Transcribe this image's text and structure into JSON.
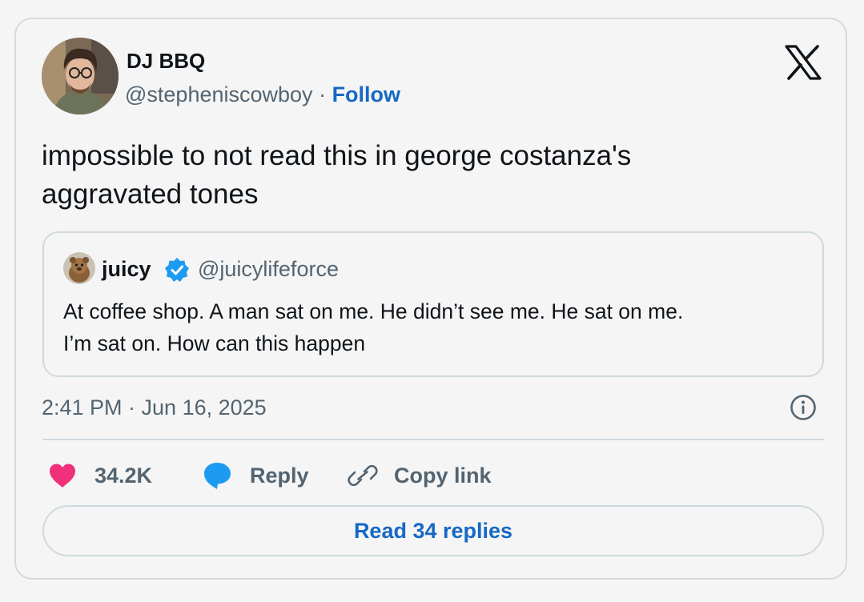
{
  "tweet": {
    "author": {
      "display_name": "DJ BBQ",
      "handle": "@stepheniscowboy",
      "separator": "·",
      "follow_label": "Follow",
      "avatar_icon": "profile-photo-avatar"
    },
    "brand_icon": "x-logo-icon",
    "text_line1": "impossible to not read this in george costanza's",
    "text_line2": "aggravated tones",
    "quoted": {
      "display_name": "juicy",
      "verified_icon": "verified-badge-icon",
      "handle": "@juicylifeforce",
      "text_line1": "At coffee shop. A man sat on me. He didn’t see me. He sat on me.",
      "text_line2": "I’m sat on. How can this happen"
    },
    "timestamp": "2:41 PM · Jun 16, 2025",
    "actions": {
      "like_count": "34.2K",
      "reply_label": "Reply",
      "copy_label": "Copy link"
    },
    "read_replies_label": "Read 34 replies"
  },
  "colors": {
    "background": "#f5f5f5",
    "text": "#0f1419",
    "muted": "#536471",
    "link": "#1668c4",
    "like": "#f0307a",
    "reply_bubble": "#1d9bf0",
    "verified": "#1d9bf0",
    "border": "#cfd9de"
  }
}
